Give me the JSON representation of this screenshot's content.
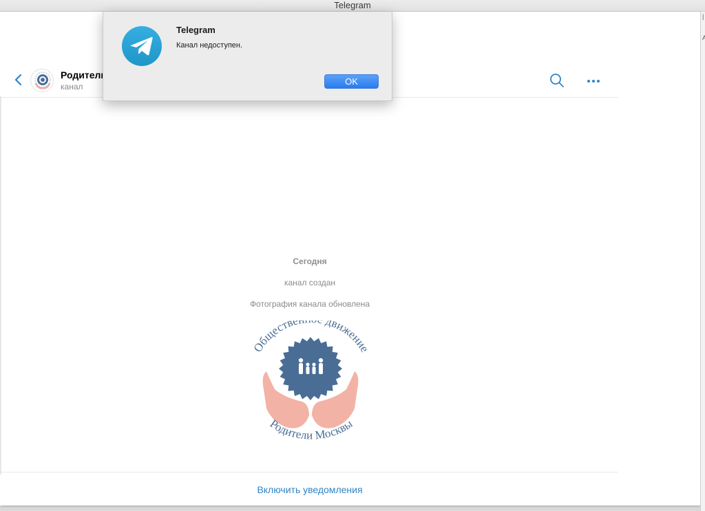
{
  "window": {
    "title": "Telegram"
  },
  "dialog": {
    "app_name": "Telegram",
    "message": "Канал недоступен.",
    "ok_label": "OK"
  },
  "chat_header": {
    "title": "Родители",
    "subtitle": "канал"
  },
  "chat": {
    "date": "Сегодня",
    "service_messages": [
      "канал создан",
      "Фотография канала обновлена"
    ],
    "channel_photo": {
      "text_top": "Общественное движение",
      "text_bottom": "Родители Москвы"
    }
  },
  "bottom_bar": {
    "notify_label": "Включить уведомления"
  },
  "right_strip": {
    "mark_top": "|",
    "mark_bottom": "A"
  },
  "colors": {
    "accent": "#2f84c5",
    "seal": "#4a6d96",
    "hands": "#f2b3a6",
    "ok_button": "#2b7cef"
  }
}
